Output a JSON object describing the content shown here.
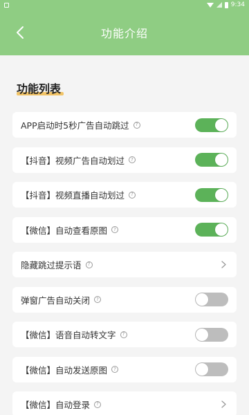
{
  "status_bar": {
    "time": "9:34"
  },
  "header": {
    "title": "功能介绍"
  },
  "section": {
    "title": "功能列表"
  },
  "colors": {
    "header_bg": "#8fcd83",
    "toggle_on": "#5cb259",
    "toggle_off": "#bdbdbd",
    "underline": "#f2c467"
  },
  "items": [
    {
      "label": "APP启动时5秒广告自动跳过",
      "control": "toggle",
      "state": "on"
    },
    {
      "label": "【抖音】视频广告自动划过",
      "control": "toggle",
      "state": "on"
    },
    {
      "label": "【抖音】视频直播自动划过",
      "control": "toggle",
      "state": "on"
    },
    {
      "label": "【微信】自动查看原图",
      "control": "toggle",
      "state": "on"
    },
    {
      "label": "隐藏跳过提示语",
      "control": "chevron"
    },
    {
      "label": "弹窗广告自动关闭",
      "control": "toggle",
      "state": "off"
    },
    {
      "label": "【微信】语音自动转文字",
      "control": "toggle",
      "state": "off"
    },
    {
      "label": "【微信】自动发送原图",
      "control": "toggle",
      "state": "off"
    },
    {
      "label": "【微信】自动登录",
      "control": "chevron"
    }
  ]
}
